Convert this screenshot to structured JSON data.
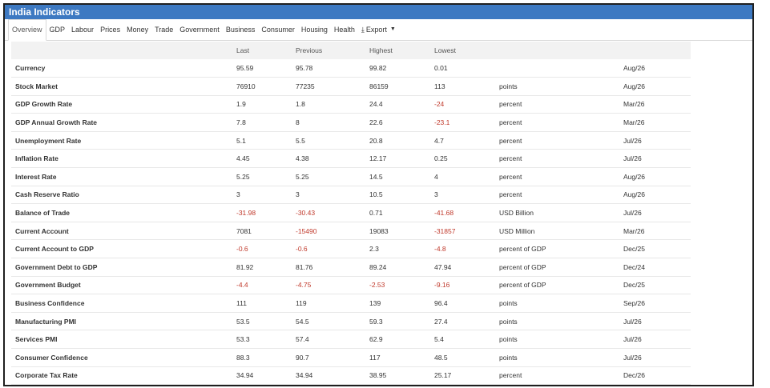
{
  "title": "India Indicators",
  "tabs": [
    "Overview",
    "GDP",
    "Labour",
    "Prices",
    "Money",
    "Trade",
    "Government",
    "Business",
    "Consumer",
    "Housing",
    "Health"
  ],
  "export_label": "Export",
  "columns": [
    "Last",
    "Previous",
    "Highest",
    "Lowest"
  ],
  "rows": [
    {
      "name": "Currency",
      "last": "95.59",
      "prev": "95.78",
      "high": "99.82",
      "low": "0.01",
      "unit": "",
      "date": "Aug/26"
    },
    {
      "name": "Stock Market",
      "last": "76910",
      "prev": "77235",
      "high": "86159",
      "low": "113",
      "unit": "points",
      "date": "Aug/26"
    },
    {
      "name": "GDP Growth Rate",
      "last": "1.9",
      "prev": "1.8",
      "high": "24.4",
      "low": "-24",
      "unit": "percent",
      "date": "Mar/26"
    },
    {
      "name": "GDP Annual Growth Rate",
      "last": "7.8",
      "prev": "8",
      "high": "22.6",
      "low": "-23.1",
      "unit": "percent",
      "date": "Mar/26"
    },
    {
      "name": "Unemployment Rate",
      "last": "5.1",
      "prev": "5.5",
      "high": "20.8",
      "low": "4.7",
      "unit": "percent",
      "date": "Jul/26"
    },
    {
      "name": "Inflation Rate",
      "last": "4.45",
      "prev": "4.38",
      "high": "12.17",
      "low": "0.25",
      "unit": "percent",
      "date": "Jul/26"
    },
    {
      "name": "Interest Rate",
      "last": "5.25",
      "prev": "5.25",
      "high": "14.5",
      "low": "4",
      "unit": "percent",
      "date": "Aug/26"
    },
    {
      "name": "Cash Reserve Ratio",
      "last": "3",
      "prev": "3",
      "high": "10.5",
      "low": "3",
      "unit": "percent",
      "date": "Aug/26"
    },
    {
      "name": "Balance of Trade",
      "last": "-31.98",
      "prev": "-30.43",
      "high": "0.71",
      "low": "-41.68",
      "unit": "USD Billion",
      "date": "Jul/26"
    },
    {
      "name": "Current Account",
      "last": "7081",
      "prev": "-15490",
      "high": "19083",
      "low": "-31857",
      "unit": "USD Million",
      "date": "Mar/26"
    },
    {
      "name": "Current Account to GDP",
      "last": "-0.6",
      "prev": "-0.6",
      "high": "2.3",
      "low": "-4.8",
      "unit": "percent of GDP",
      "date": "Dec/25"
    },
    {
      "name": "Government Debt to GDP",
      "last": "81.92",
      "prev": "81.76",
      "high": "89.24",
      "low": "47.94",
      "unit": "percent of GDP",
      "date": "Dec/24"
    },
    {
      "name": "Government Budget",
      "last": "-4.4",
      "prev": "-4.75",
      "high": "-2.53",
      "low": "-9.16",
      "unit": "percent of GDP",
      "date": "Dec/25"
    },
    {
      "name": "Business Confidence",
      "last": "111",
      "prev": "119",
      "high": "139",
      "low": "96.4",
      "unit": "points",
      "date": "Sep/26"
    },
    {
      "name": "Manufacturing PMI",
      "last": "53.5",
      "prev": "54.5",
      "high": "59.3",
      "low": "27.4",
      "unit": "points",
      "date": "Jul/26"
    },
    {
      "name": "Services PMI",
      "last": "53.3",
      "prev": "57.4",
      "high": "62.9",
      "low": "5.4",
      "unit": "points",
      "date": "Jul/26"
    },
    {
      "name": "Consumer Confidence",
      "last": "88.3",
      "prev": "90.7",
      "high": "117",
      "low": "48.5",
      "unit": "points",
      "date": "Jul/26"
    },
    {
      "name": "Corporate Tax Rate",
      "last": "34.94",
      "prev": "34.94",
      "high": "38.95",
      "low": "25.17",
      "unit": "percent",
      "date": "Dec/26"
    }
  ]
}
